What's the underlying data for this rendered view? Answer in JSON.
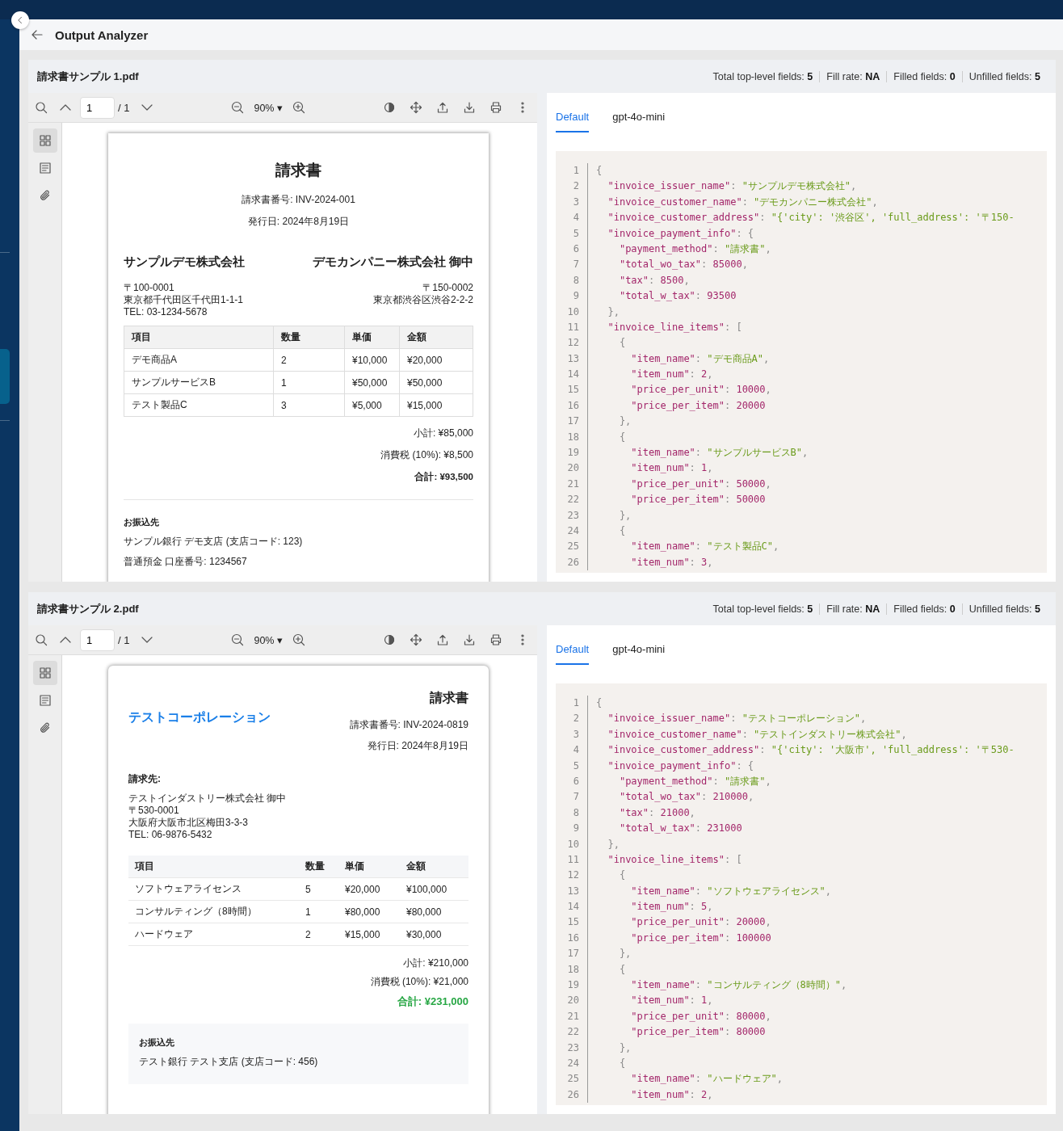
{
  "app": {
    "title": "Output Analyzer"
  },
  "documents": [
    {
      "file_name": "請求書サンプル 1.pdf",
      "stats": [
        {
          "label": "Total top-level fields:",
          "value": "5"
        },
        {
          "label": "Fill rate:",
          "value": "NA"
        },
        {
          "label": "Filled fields:",
          "value": "0"
        },
        {
          "label": "Unfilled fields:",
          "value": "5"
        }
      ],
      "viewer": {
        "page_input": "1",
        "page_total": "/ 1",
        "zoom": "90%",
        "zoom_caret": "▾"
      },
      "sidebar_tools": [
        {
          "kind": "thumbnails",
          "selected": true
        },
        {
          "kind": "outline",
          "selected": false
        },
        {
          "kind": "attachments",
          "selected": false
        }
      ],
      "invoice": {
        "kind": "centered",
        "title": "請求書",
        "number": "請求書番号: INV-2024-001",
        "date": "発行日: 2024年8月19日",
        "issuer": {
          "name": "サンプルデモ株式会社",
          "lines": [
            "〒100-0001",
            "東京都千代田区千代田1-1-1",
            "TEL: 03-1234-5678"
          ]
        },
        "customer": {
          "name": "デモカンパニー株式会社 御中",
          "lines": [
            "〒150-0002",
            "東京都渋谷区渋谷2-2-2"
          ]
        },
        "columns": [
          "項目",
          "数量",
          "単価",
          "金額"
        ],
        "rows": [
          [
            "デモ商品A",
            "2",
            "¥10,000",
            "¥20,000"
          ],
          [
            "サンプルサービスB",
            "1",
            "¥50,000",
            "¥50,000"
          ],
          [
            "テスト製品C",
            "3",
            "¥5,000",
            "¥15,000"
          ]
        ],
        "subtotal": "小計: ¥85,000",
        "tax": "消費税 (10%): ¥8,500",
        "total": "合計: ¥93,500",
        "bank": {
          "heading": "お振込先",
          "lines": [
            "サンプル銀行 デモ支店 (支店コード: 123)",
            "普通預金 口座番号: 1234567"
          ]
        }
      },
      "result_tabs": [
        {
          "label": "Default",
          "selected": true
        },
        {
          "label": "gpt-4o-mini",
          "selected": false
        }
      ],
      "code_lines": [
        {
          "number": "1",
          "text": "{"
        },
        {
          "number": "2",
          "text": "  \"invoice_issuer_name\": \"サンプルデモ株式会社\","
        },
        {
          "number": "3",
          "text": "  \"invoice_customer_name\": \"デモカンパニー株式会社\","
        },
        {
          "number": "4",
          "text": "  \"invoice_customer_address\": \"{'city': '渋谷区', 'full_address': '〒150-"
        },
        {
          "number": "5",
          "text": "  \"invoice_payment_info\": {"
        },
        {
          "number": "6",
          "text": "    \"payment_method\": \"請求書\","
        },
        {
          "number": "7",
          "text": "    \"total_wo_tax\": 85000,"
        },
        {
          "number": "8",
          "text": "    \"tax\": 8500,"
        },
        {
          "number": "9",
          "text": "    \"total_w_tax\": 93500"
        },
        {
          "number": "10",
          "text": "  },"
        },
        {
          "number": "11",
          "text": "  \"invoice_line_items\": ["
        },
        {
          "number": "12",
          "text": "    {"
        },
        {
          "number": "13",
          "text": "      \"item_name\": \"デモ商品A\","
        },
        {
          "number": "14",
          "text": "      \"item_num\": 2,"
        },
        {
          "number": "15",
          "text": "      \"price_per_unit\": 10000,"
        },
        {
          "number": "16",
          "text": "      \"price_per_item\": 20000"
        },
        {
          "number": "17",
          "text": "    },"
        },
        {
          "number": "18",
          "text": "    {"
        },
        {
          "number": "19",
          "text": "      \"item_name\": \"サンプルサービスB\","
        },
        {
          "number": "20",
          "text": "      \"item_num\": 1,"
        },
        {
          "number": "21",
          "text": "      \"price_per_unit\": 50000,"
        },
        {
          "number": "22",
          "text": "      \"price_per_item\": 50000"
        },
        {
          "number": "23",
          "text": "    },"
        },
        {
          "number": "24",
          "text": "    {"
        },
        {
          "number": "25",
          "text": "      \"item_name\": \"テスト製品C\","
        },
        {
          "number": "26",
          "text": "      \"item_num\": 3,"
        }
      ]
    },
    {
      "file_name": "請求書サンプル 2.pdf",
      "stats": [
        {
          "label": "Total top-level fields:",
          "value": "5"
        },
        {
          "label": "Fill rate:",
          "value": "NA"
        },
        {
          "label": "Filled fields:",
          "value": "0"
        },
        {
          "label": "Unfilled fields:",
          "value": "5"
        }
      ],
      "viewer": {
        "page_input": "1",
        "page_total": "/ 1",
        "zoom": "90%",
        "zoom_caret": "▾"
      },
      "sidebar_tools": [
        {
          "kind": "thumbnails",
          "selected": true
        },
        {
          "kind": "outline",
          "selected": false
        },
        {
          "kind": "attachments",
          "selected": false
        }
      ],
      "invoice": {
        "kind": "letterhead",
        "title": "請求書",
        "number": "請求書番号: INV-2024-0819",
        "date": "発行日: 2024年8月19日",
        "issuer": {
          "name": "テストコーポレーション"
        },
        "bill_to": "請求先:",
        "customer": {
          "lines": [
            "テストインダストリー株式会社 御中",
            "〒530-0001",
            "大阪府大阪市北区梅田3-3-3",
            "TEL: 06-9876-5432"
          ]
        },
        "columns": [
          "項目",
          "数量",
          "単価",
          "金額"
        ],
        "rows": [
          [
            "ソフトウェアライセンス",
            "5",
            "¥20,000",
            "¥100,000"
          ],
          [
            "コンサルティング（8時間）",
            "1",
            "¥80,000",
            "¥80,000"
          ],
          [
            "ハードウェア",
            "2",
            "¥15,000",
            "¥30,000"
          ]
        ],
        "subtotal": "小計: ¥210,000",
        "tax": "消費税 (10%): ¥21,000",
        "total": "合計: ¥231,000",
        "bank": {
          "heading": "お振込先",
          "lines": [
            "テスト銀行 テスト支店 (支店コード: 456)"
          ]
        }
      },
      "result_tabs": [
        {
          "label": "Default",
          "selected": true
        },
        {
          "label": "gpt-4o-mini",
          "selected": false
        }
      ],
      "code_lines": [
        {
          "number": "1",
          "text": "{"
        },
        {
          "number": "2",
          "text": "  \"invoice_issuer_name\": \"テストコーポレーション\","
        },
        {
          "number": "3",
          "text": "  \"invoice_customer_name\": \"テストインダストリー株式会社\","
        },
        {
          "number": "4",
          "text": "  \"invoice_customer_address\": \"{'city': '大阪市', 'full_address': '〒530-"
        },
        {
          "number": "5",
          "text": "  \"invoice_payment_info\": {"
        },
        {
          "number": "6",
          "text": "    \"payment_method\": \"請求書\","
        },
        {
          "number": "7",
          "text": "    \"total_wo_tax\": 210000,"
        },
        {
          "number": "8",
          "text": "    \"tax\": 21000,"
        },
        {
          "number": "9",
          "text": "    \"total_w_tax\": 231000"
        },
        {
          "number": "10",
          "text": "  },"
        },
        {
          "number": "11",
          "text": "  \"invoice_line_items\": ["
        },
        {
          "number": "12",
          "text": "    {"
        },
        {
          "number": "13",
          "text": "      \"item_name\": \"ソフトウェアライセンス\","
        },
        {
          "number": "14",
          "text": "      \"item_num\": 5,"
        },
        {
          "number": "15",
          "text": "      \"price_per_unit\": 20000,"
        },
        {
          "number": "16",
          "text": "      \"price_per_item\": 100000"
        },
        {
          "number": "17",
          "text": "    },"
        },
        {
          "number": "18",
          "text": "    {"
        },
        {
          "number": "19",
          "text": "      \"item_name\": \"コンサルティング（8時間）\","
        },
        {
          "number": "20",
          "text": "      \"item_num\": 1,"
        },
        {
          "number": "21",
          "text": "      \"price_per_unit\": 80000,"
        },
        {
          "number": "22",
          "text": "      \"price_per_item\": 80000"
        },
        {
          "number": "23",
          "text": "    },"
        },
        {
          "number": "24",
          "text": "    {"
        },
        {
          "number": "25",
          "text": "      \"item_name\": \"ハードウェア\","
        },
        {
          "number": "26",
          "text": "      \"item_num\": 2,"
        }
      ]
    }
  ]
}
